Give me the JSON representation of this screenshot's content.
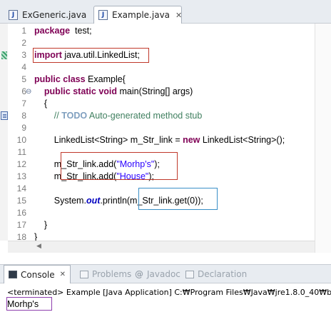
{
  "tabs": [
    {
      "label": "ExGeneric.java",
      "active": false
    },
    {
      "label": "Example.java",
      "active": true
    }
  ],
  "editor": {
    "lines": [
      {
        "n": "1",
        "parts": [
          [
            "kw",
            "package"
          ],
          [
            "",
            "  test;"
          ]
        ]
      },
      {
        "n": "2",
        "parts": []
      },
      {
        "n": "3",
        "parts": [
          [
            "kw",
            "import"
          ],
          [
            "",
            " java.util.LinkedList;"
          ]
        ]
      },
      {
        "n": "4",
        "parts": []
      },
      {
        "n": "5",
        "parts": [
          [
            "kw",
            "public"
          ],
          [
            "",
            " "
          ],
          [
            "kw",
            "class"
          ],
          [
            "",
            " Example{"
          ]
        ]
      },
      {
        "n": "6",
        "parts": [
          [
            "",
            "    "
          ],
          [
            "kw",
            "public"
          ],
          [
            "",
            " "
          ],
          [
            "kw",
            "static"
          ],
          [
            "",
            " "
          ],
          [
            "kw",
            "void"
          ],
          [
            "",
            " main(String[] args)"
          ]
        ]
      },
      {
        "n": "7",
        "parts": [
          [
            "",
            "    {"
          ]
        ]
      },
      {
        "n": "8",
        "parts": [
          [
            "",
            "        "
          ],
          [
            "cmt",
            "// "
          ],
          [
            "todo",
            "TODO"
          ],
          [
            "cmt",
            " Auto-generated method stub"
          ]
        ]
      },
      {
        "n": "9",
        "parts": []
      },
      {
        "n": "10",
        "parts": [
          [
            "",
            "        LinkedList<String> m_Str_link = "
          ],
          [
            "kw",
            "new"
          ],
          [
            "",
            " LinkedList<String>();"
          ]
        ]
      },
      {
        "n": "11",
        "parts": []
      },
      {
        "n": "12",
        "parts": [
          [
            "",
            "        m_Str_link.add("
          ],
          [
            "str",
            "\"Morhp's\""
          ],
          [
            "",
            ");"
          ]
        ]
      },
      {
        "n": "13",
        "parts": [
          [
            "",
            "        m_Str_link.add("
          ],
          [
            "str",
            "\"House\""
          ],
          [
            "",
            ");"
          ]
        ]
      },
      {
        "n": "14",
        "parts": []
      },
      {
        "n": "15",
        "parts": [
          [
            "",
            "        System."
          ],
          [
            "stat",
            "out"
          ],
          [
            "",
            ".println(m_Str_link.get(0));"
          ]
        ]
      },
      {
        "n": "16",
        "parts": []
      },
      {
        "n": "17",
        "parts": [
          [
            "",
            "    }"
          ]
        ]
      },
      {
        "n": "18",
        "parts": [
          [
            "",
            "}"
          ]
        ]
      }
    ]
  },
  "console": {
    "tabs": [
      {
        "label": "Console",
        "suffix": "✕",
        "active": true
      },
      {
        "label": "Problems",
        "active": false
      },
      {
        "label": "Javadoc",
        "active": false
      },
      {
        "label": "Declaration",
        "active": false
      }
    ],
    "terminated": "<terminated> Example [Java Application] C:₩Program Files₩Java₩jre1.8.0_40₩b",
    "output": "Morhp's"
  },
  "icons": {
    "java_file": "java-file-icon",
    "close": "close-icon",
    "console": "console-icon",
    "problems": "problems-icon",
    "javadoc": "javadoc-icon",
    "declaration": "declaration-icon"
  }
}
